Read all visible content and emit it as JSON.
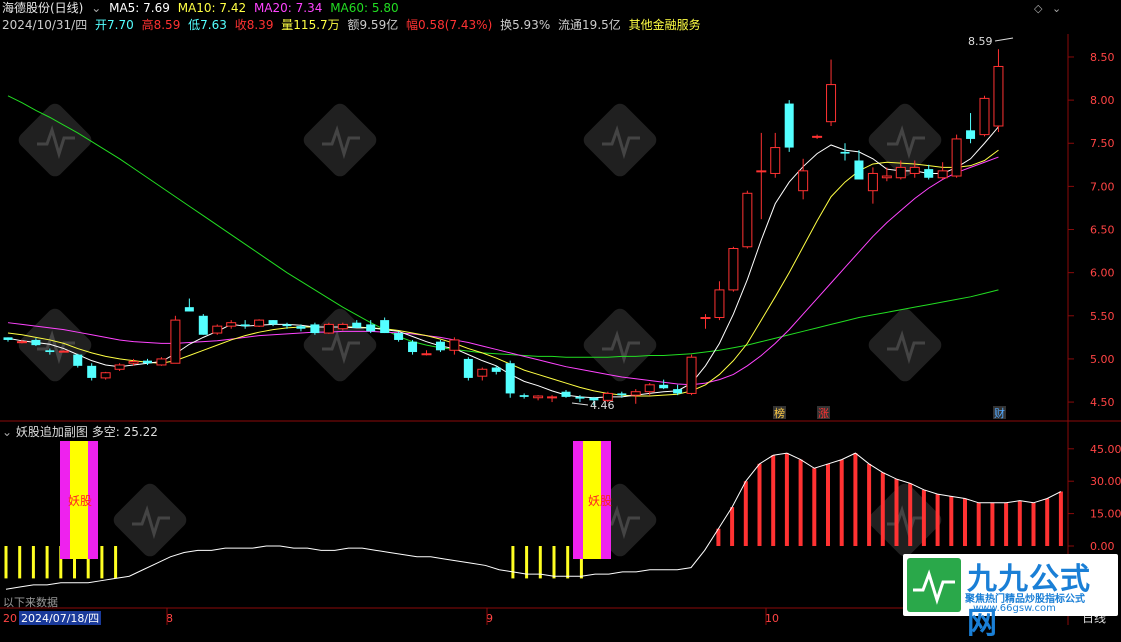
{
  "header": {
    "stock_title": "海德股份(日线)",
    "ma5": "MA5: 7.69",
    "ma10": "MA10: 7.42",
    "ma20": "MA20: 7.34",
    "ma60": "MA60: 5.80",
    "date": "2024/10/31/四",
    "open": "开7.70",
    "high": "高8.59",
    "low": "低7.63",
    "close": "收8.39",
    "volume": "量115.7万",
    "amount": "额9.59亿",
    "change": "幅0.58(7.43%)",
    "turnover": "换5.93%",
    "float": "流通19.5亿",
    "industry": "其他金融服务"
  },
  "colors": {
    "up": "#ff3232",
    "down": "#54ffff",
    "ma5": "#ffffff",
    "ma10": "#ffff44",
    "ma20": "#ff44ff",
    "ma60": "#22dd22",
    "grid": "#7a0a0a"
  },
  "price_axis": [
    "8.50",
    "8.00",
    "7.50",
    "7.00",
    "6.50",
    "6.00",
    "5.50",
    "5.00",
    "4.50"
  ],
  "annotations": {
    "high_mark": "8.59",
    "low_mark": "4.46",
    "tag1": "榜",
    "tag2": "涨",
    "tag3": "财"
  },
  "sub_panel": {
    "title": "妖股追加副图",
    "value": "多空: 25.22",
    "axis": [
      "45.00",
      "30.00",
      "15.00",
      "0.00"
    ],
    "marker1": "妖股",
    "marker2": "妖股",
    "no_data": "以下来数据"
  },
  "date_axis": {
    "d0": "20",
    "d1": "2024/07/18/四",
    "m8": "8",
    "m9": "9",
    "m10": "10",
    "period": "日线"
  },
  "watermark": {
    "title": "九九公式网",
    "subtitle": "聚焦热门精品炒股指标公式",
    "url": "www.66gsw.com"
  },
  "chart_data": {
    "type": "candlestick",
    "candles": [
      [
        5.25,
        5.25,
        5.2,
        5.22
      ],
      [
        5.2,
        5.22,
        5.18,
        5.2
      ],
      [
        5.22,
        5.24,
        5.15,
        5.16
      ],
      [
        5.1,
        5.12,
        5.05,
        5.08
      ],
      [
        5.08,
        5.1,
        5.08,
        5.09
      ],
      [
        5.05,
        5.06,
        4.9,
        4.92
      ],
      [
        4.92,
        4.95,
        4.75,
        4.78
      ],
      [
        4.78,
        4.85,
        4.76,
        4.84
      ],
      [
        4.88,
        4.95,
        4.86,
        4.93
      ],
      [
        4.95,
        5.0,
        4.92,
        4.97
      ],
      [
        4.98,
        5.0,
        4.93,
        4.95
      ],
      [
        4.93,
        5.02,
        4.92,
        5.0
      ],
      [
        4.95,
        5.5,
        4.95,
        5.45
      ],
      [
        5.6,
        5.7,
        5.55,
        5.55
      ],
      [
        5.5,
        5.52,
        5.28,
        5.28
      ],
      [
        5.3,
        5.4,
        5.28,
        5.38
      ],
      [
        5.38,
        5.45,
        5.35,
        5.42
      ],
      [
        5.4,
        5.45,
        5.35,
        5.38
      ],
      [
        5.38,
        5.46,
        5.37,
        5.45
      ],
      [
        5.45,
        5.45,
        5.38,
        5.4
      ],
      [
        5.4,
        5.42,
        5.35,
        5.38
      ],
      [
        5.38,
        5.4,
        5.32,
        5.35
      ],
      [
        5.4,
        5.42,
        5.28,
        5.3
      ],
      [
        5.3,
        5.42,
        5.29,
        5.4
      ],
      [
        5.35,
        5.42,
        5.33,
        5.4
      ],
      [
        5.42,
        5.45,
        5.36,
        5.36
      ],
      [
        5.4,
        5.45,
        5.3,
        5.32
      ],
      [
        5.45,
        5.48,
        5.3,
        5.3
      ],
      [
        5.3,
        5.32,
        5.2,
        5.22
      ],
      [
        5.2,
        5.22,
        5.05,
        5.08
      ],
      [
        5.05,
        5.1,
        5.04,
        5.06
      ],
      [
        5.2,
        5.22,
        5.08,
        5.1
      ],
      [
        5.1,
        5.25,
        5.05,
        5.22
      ],
      [
        5.0,
        5.02,
        4.75,
        4.78
      ],
      [
        4.8,
        4.9,
        4.75,
        4.88
      ],
      [
        4.9,
        4.92,
        4.82,
        4.85
      ],
      [
        4.95,
        4.98,
        4.55,
        4.6
      ],
      [
        4.58,
        4.6,
        4.54,
        4.56
      ],
      [
        4.55,
        4.58,
        4.52,
        4.57
      ],
      [
        4.55,
        4.58,
        4.5,
        4.56
      ],
      [
        4.62,
        4.64,
        4.55,
        4.56
      ],
      [
        4.56,
        4.58,
        4.5,
        4.54
      ],
      [
        4.55,
        4.56,
        4.46,
        4.52
      ],
      [
        4.52,
        4.62,
        4.5,
        4.6
      ],
      [
        4.6,
        4.62,
        4.55,
        4.58
      ],
      [
        4.58,
        4.65,
        4.48,
        4.62
      ],
      [
        4.62,
        4.72,
        4.58,
        4.7
      ],
      [
        4.7,
        4.76,
        4.65,
        4.66
      ],
      [
        4.65,
        4.7,
        4.58,
        4.6
      ],
      [
        4.6,
        5.05,
        4.58,
        5.02
      ],
      [
        5.48,
        5.52,
        5.35,
        5.48
      ],
      [
        5.48,
        5.9,
        5.45,
        5.8
      ],
      [
        5.8,
        6.3,
        5.78,
        6.28
      ],
      [
        6.3,
        6.95,
        6.28,
        6.92
      ],
      [
        7.18,
        7.62,
        6.62,
        7.18
      ],
      [
        7.15,
        7.62,
        7.1,
        7.45
      ],
      [
        7.96,
        8.0,
        7.4,
        7.45
      ],
      [
        6.95,
        7.32,
        6.85,
        7.18
      ],
      [
        7.58,
        7.6,
        7.55,
        7.58
      ],
      [
        7.75,
        8.47,
        7.7,
        8.18
      ],
      [
        7.4,
        7.5,
        7.3,
        7.38
      ],
      [
        7.3,
        7.42,
        7.1,
        7.08
      ],
      [
        6.95,
        7.22,
        6.8,
        7.15
      ],
      [
        7.1,
        7.22,
        7.06,
        7.12
      ],
      [
        7.1,
        7.3,
        7.08,
        7.22
      ],
      [
        7.15,
        7.3,
        7.1,
        7.22
      ],
      [
        7.2,
        7.25,
        7.08,
        7.1
      ],
      [
        7.1,
        7.28,
        7.08,
        7.18
      ],
      [
        7.12,
        7.6,
        7.1,
        7.55
      ],
      [
        7.65,
        7.85,
        7.5,
        7.55
      ],
      [
        7.6,
        8.05,
        7.58,
        8.02
      ],
      [
        7.7,
        8.59,
        7.63,
        8.39
      ]
    ],
    "ma5": [
      5.24,
      5.21,
      5.19,
      5.17,
      5.12,
      5.05,
      4.98,
      4.93,
      4.91,
      4.93,
      4.95,
      4.97,
      5.06,
      5.17,
      5.25,
      5.32,
      5.4,
      5.38,
      5.39,
      5.4,
      5.4,
      5.39,
      5.37,
      5.37,
      5.37,
      5.36,
      5.36,
      5.34,
      5.32,
      5.26,
      5.2,
      5.15,
      5.12,
      5.05,
      4.98,
      4.92,
      4.82,
      4.74,
      4.69,
      4.63,
      4.58,
      4.56,
      4.55,
      4.56,
      4.56,
      4.58,
      4.6,
      4.62,
      4.63,
      4.72,
      4.92,
      5.18,
      5.52,
      5.92,
      6.38,
      6.8,
      7.05,
      7.23,
      7.38,
      7.48,
      7.42,
      7.4,
      7.32,
      7.2,
      7.18,
      7.18,
      7.15,
      7.15,
      7.22,
      7.32,
      7.5,
      7.69
    ],
    "ma10": [
      5.3,
      5.28,
      5.25,
      5.22,
      5.18,
      5.12,
      5.07,
      5.03,
      5.0,
      4.98,
      4.96,
      4.95,
      4.98,
      5.04,
      5.1,
      5.16,
      5.22,
      5.27,
      5.31,
      5.34,
      5.36,
      5.37,
      5.37,
      5.37,
      5.37,
      5.37,
      5.36,
      5.35,
      5.33,
      5.3,
      5.27,
      5.23,
      5.18,
      5.12,
      5.07,
      5.01,
      4.94,
      4.87,
      4.82,
      4.77,
      4.72,
      4.67,
      4.63,
      4.6,
      4.58,
      4.57,
      4.57,
      4.58,
      4.59,
      4.63,
      4.7,
      4.82,
      4.98,
      5.18,
      5.45,
      5.72,
      6.0,
      6.3,
      6.6,
      6.88,
      7.05,
      7.18,
      7.26,
      7.28,
      7.27,
      7.26,
      7.24,
      7.22,
      7.22,
      7.24,
      7.3,
      7.42
    ],
    "ma20": [
      5.42,
      5.4,
      5.38,
      5.36,
      5.34,
      5.31,
      5.28,
      5.25,
      5.22,
      5.2,
      5.19,
      5.18,
      5.18,
      5.19,
      5.2,
      5.21,
      5.23,
      5.25,
      5.27,
      5.28,
      5.29,
      5.3,
      5.31,
      5.31,
      5.32,
      5.32,
      5.32,
      5.31,
      5.3,
      5.29,
      5.27,
      5.25,
      5.22,
      5.19,
      5.15,
      5.11,
      5.07,
      5.03,
      4.99,
      4.95,
      4.91,
      4.88,
      4.85,
      4.82,
      4.79,
      4.77,
      4.75,
      4.73,
      4.71,
      4.7,
      4.72,
      4.76,
      4.82,
      4.92,
      5.04,
      5.18,
      5.34,
      5.52,
      5.7,
      5.88,
      6.06,
      6.24,
      6.42,
      6.58,
      6.72,
      6.86,
      6.98,
      7.08,
      7.16,
      7.22,
      7.28,
      7.34
    ],
    "ma60": [
      8.05,
      7.97,
      7.88,
      7.8,
      7.71,
      7.62,
      7.52,
      7.42,
      7.32,
      7.21,
      7.1,
      6.99,
      6.88,
      6.77,
      6.66,
      6.55,
      6.44,
      6.33,
      6.22,
      6.11,
      6.0,
      5.9,
      5.8,
      5.7,
      5.6,
      5.51,
      5.42,
      5.34,
      5.26,
      5.2,
      5.16,
      5.13,
      5.11,
      5.09,
      5.07,
      5.06,
      5.05,
      5.04,
      5.03,
      5.03,
      5.02,
      5.02,
      5.02,
      5.02,
      5.03,
      5.03,
      5.04,
      5.04,
      5.05,
      5.06,
      5.08,
      5.1,
      5.13,
      5.16,
      5.2,
      5.24,
      5.28,
      5.32,
      5.36,
      5.4,
      5.44,
      5.48,
      5.51,
      5.54,
      5.57,
      5.6,
      5.63,
      5.66,
      5.69,
      5.72,
      5.76,
      5.8
    ],
    "sub_values": [
      -20,
      -19,
      -18,
      -18,
      -17,
      -17,
      -17,
      -16,
      -15,
      -14,
      -11,
      -8,
      -5,
      -3,
      -2,
      -2,
      -1,
      -1,
      -1,
      0,
      0,
      -1,
      -1,
      -2,
      -2,
      -1,
      -1,
      -2,
      -3,
      -4,
      -5,
      -5,
      -6,
      -7,
      -8,
      -9,
      -11,
      -12,
      -13,
      -13,
      -14,
      -14,
      -14,
      -13,
      -13,
      -12,
      -12,
      -11,
      -11,
      -11,
      -10,
      -2,
      8,
      18,
      30,
      38,
      42,
      43,
      40,
      36,
      38,
      40,
      43,
      38,
      34,
      31,
      29,
      26,
      24,
      23,
      22,
      20,
      20,
      20,
      21,
      20,
      22,
      25.22
    ],
    "sub_range": [
      -25,
      50
    ],
    "price_range": [
      4.35,
      8.72
    ]
  }
}
